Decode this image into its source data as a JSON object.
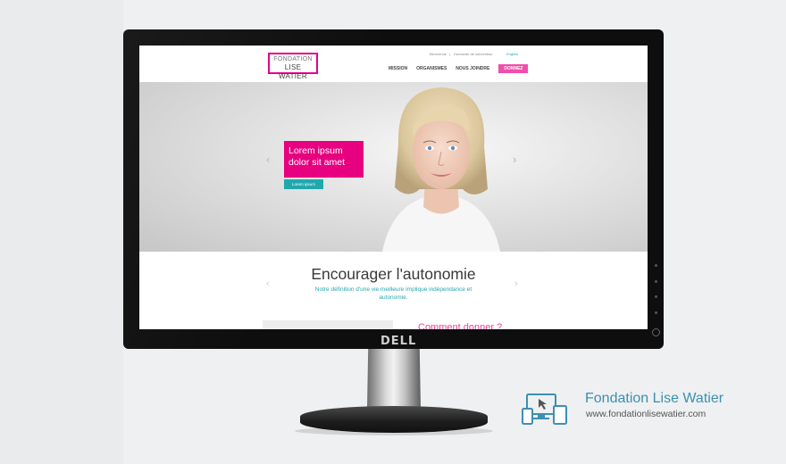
{
  "site": {
    "logo": {
      "line1": "FONDATION",
      "line2": "LISE WATIER"
    },
    "utility": {
      "links": [
        "Bienvenue",
        "Demande de subvention"
      ],
      "language": "English"
    },
    "nav": {
      "items": [
        "MISSION",
        "ORGANISMES",
        "NOUS JOINDRE"
      ],
      "donate": "DONNEZ"
    },
    "hero": {
      "headline": "Lorem ipsum dolor sit amet",
      "button": "Lorem ipsum",
      "prev_arrow": "‹",
      "next_arrow": "›"
    },
    "content": {
      "title": "Encourager l'autonomie",
      "subtitle": "Notre définition d'une vie meilleure implique indépendance et autonomie.",
      "give_link": "Comment donner ?",
      "prev_arrow": "‹",
      "next_arrow": "›"
    }
  },
  "monitor": {
    "brand": "DELL"
  },
  "branding": {
    "title": "Fondation Lise Watier",
    "url": "www.fondationlisewatier.com",
    "icon": "responsive-devices-icon"
  },
  "colors": {
    "magenta": "#e7007f",
    "teal": "#22a7ad",
    "pink_button": "#ef4eaa",
    "brand_blue": "#3d8fb1"
  }
}
